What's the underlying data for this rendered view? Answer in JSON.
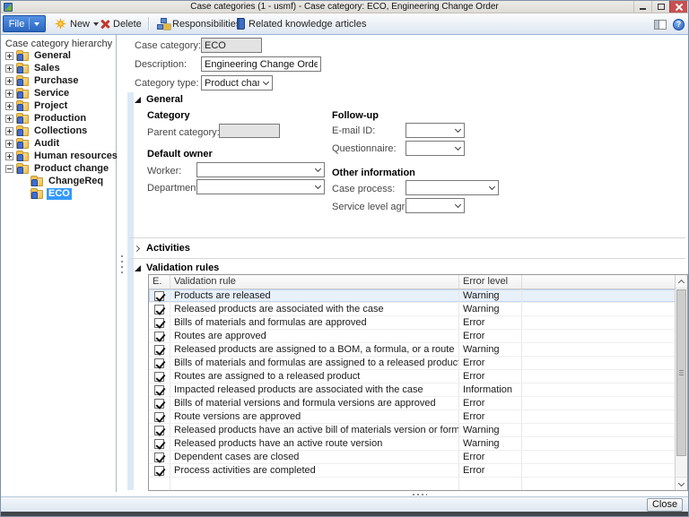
{
  "window": {
    "title": "Case categories (1 - usmf) - Case category: ECO, Engineering Change Order"
  },
  "toolbar": {
    "file": "File",
    "new": "New",
    "delete": "Delete",
    "responsibilities": "Responsibilities",
    "related_articles": "Related knowledge articles"
  },
  "icons": {
    "new": "star-burst",
    "delete": "red-x",
    "responsibilities": "org-chart",
    "related_articles": "blue-book",
    "layout": "navigation-pane",
    "help": "question-circle",
    "window_controls": [
      "minimize",
      "restore",
      "close"
    ],
    "tree_item": "category-folder"
  },
  "colors": {
    "accent_blue": "#2a66c0",
    "selection_blue": "#3399ff",
    "close_button_red": "#c75050",
    "folder_yellow": "#f3c14f"
  },
  "tree": {
    "header": "Case category hierarchy",
    "items": [
      {
        "label": "General",
        "level": 0,
        "expandable": true,
        "expanded": false
      },
      {
        "label": "Sales",
        "level": 0,
        "expandable": true,
        "expanded": false
      },
      {
        "label": "Purchase",
        "level": 0,
        "expandable": true,
        "expanded": false
      },
      {
        "label": "Service",
        "level": 0,
        "expandable": true,
        "expanded": false
      },
      {
        "label": "Project",
        "level": 0,
        "expandable": true,
        "expanded": false
      },
      {
        "label": "Production",
        "level": 0,
        "expandable": true,
        "expanded": false
      },
      {
        "label": "Collections",
        "level": 0,
        "expandable": true,
        "expanded": false
      },
      {
        "label": "Audit",
        "level": 0,
        "expandable": true,
        "expanded": false
      },
      {
        "label": "Human resources",
        "level": 0,
        "expandable": true,
        "expanded": false
      },
      {
        "label": "Product change",
        "level": 0,
        "expandable": true,
        "expanded": true
      },
      {
        "label": "ChangeReq",
        "level": 1,
        "expandable": false
      },
      {
        "label": "ECO",
        "level": 1,
        "expandable": false,
        "selected": true
      }
    ]
  },
  "form": {
    "case_category": {
      "label": "Case category:",
      "value": "ECO",
      "disabled": true
    },
    "description": {
      "label": "Description:",
      "value": "Engineering Change Order"
    },
    "category_type": {
      "label": "Category type:",
      "value": "Product change"
    }
  },
  "sections": {
    "general": {
      "title": "General",
      "category": {
        "title": "Category",
        "parent_label": "Parent category:",
        "parent_value": ""
      },
      "default_owner": {
        "title": "Default owner",
        "worker_label": "Worker:",
        "worker_value": "",
        "department_label": "Department:",
        "department_value": ""
      },
      "follow_up": {
        "title": "Follow-up",
        "email_label": "E-mail ID:",
        "email_value": "",
        "questionnaire_label": "Questionnaire:",
        "questionnaire_value": ""
      },
      "other_info": {
        "title": "Other information",
        "case_process_label": "Case process:",
        "case_process_value": "",
        "sla_label": "Service level agreement:",
        "sla_value": ""
      }
    },
    "activities": {
      "title": "Activities",
      "collapsed": true
    },
    "validation": {
      "title": "Validation rules",
      "columns": [
        "E.",
        "Validation rule",
        "Error level"
      ],
      "rows": [
        {
          "checked": true,
          "rule": "Products are released",
          "error_level": "Warning",
          "selected": true
        },
        {
          "checked": true,
          "rule": "Released products are associated with the case",
          "error_level": "Warning"
        },
        {
          "checked": true,
          "rule": "Bills of materials and formulas are approved",
          "error_level": "Error"
        },
        {
          "checked": true,
          "rule": "Routes are approved",
          "error_level": "Error"
        },
        {
          "checked": true,
          "rule": "Released products are assigned to a BOM, a formula, or a route",
          "error_level": "Warning"
        },
        {
          "checked": true,
          "rule": "Bills of materials and formulas are assigned to a released product",
          "error_level": "Error"
        },
        {
          "checked": true,
          "rule": "Routes are assigned to a released product",
          "error_level": "Error"
        },
        {
          "checked": true,
          "rule": "Impacted released products are associated with the case",
          "error_level": "Information"
        },
        {
          "checked": true,
          "rule": "Bills of material versions and formula versions are approved",
          "error_level": "Error"
        },
        {
          "checked": true,
          "rule": "Route versions are approved",
          "error_level": "Error"
        },
        {
          "checked": true,
          "rule": "Released products have an active bill of materials version or formula version",
          "error_level": "Warning"
        },
        {
          "checked": true,
          "rule": "Released products have an active route version",
          "error_level": "Warning"
        },
        {
          "checked": true,
          "rule": "Dependent cases are closed",
          "error_level": "Error"
        },
        {
          "checked": true,
          "rule": "Process activities are completed",
          "error_level": "Error"
        }
      ]
    }
  },
  "footer": {
    "close": "Close"
  }
}
